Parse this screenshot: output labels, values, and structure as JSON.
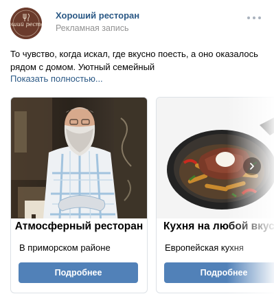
{
  "header": {
    "page_name": "Хороший ресторан",
    "ad_label": "Рекламная запись",
    "avatar_text": "Хороший ресторан",
    "more_icon": "more-dots-icon"
  },
  "post": {
    "text": "То чувство, когда искал, где вкусно поесть, а оно оказалось рядом с домом. Уютный семейный",
    "show_more": "Показать полностью..."
  },
  "carousel": {
    "cards": [
      {
        "caption": "Атмосферный ресторан",
        "description": "В приморском районе",
        "button": "Подробнее"
      },
      {
        "caption": "Кухня на любой вкус",
        "description": "Европейская кухня",
        "button": "Подробнее"
      }
    ],
    "next_icon": "chevron-right-icon"
  },
  "colors": {
    "link": "#2a5885",
    "button": "#5181b8",
    "avatar_bg": "#6b3b2c",
    "border": "#dce1e6"
  }
}
